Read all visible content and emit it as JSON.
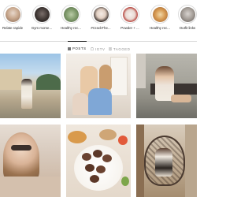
{
  "highlights": [
    {
      "label": "Relate rapide",
      "icon": "story-highlight-icon"
    },
    {
      "label": "Gym mome...",
      "icon": "story-highlight-icon"
    },
    {
      "label": "Healthy rec...",
      "icon": "story-highlight-icon"
    },
    {
      "label": "#CrackThe...",
      "icon": "story-highlight-icon"
    },
    {
      "label": "Powder + ...",
      "icon": "story-highlight-icon"
    },
    {
      "label": "Healthy rec...",
      "icon": "story-highlight-icon"
    },
    {
      "label": "Outfit links",
      "icon": "story-highlight-icon"
    }
  ],
  "tabs": [
    {
      "label": "POSTS",
      "icon": "grid-icon",
      "active": true
    },
    {
      "label": "IGTV",
      "icon": "igtv-icon",
      "active": false
    },
    {
      "label": "TAGGED",
      "icon": "tagged-icon",
      "active": false
    }
  ],
  "posts": [
    {
      "name": "post-street-outfit"
    },
    {
      "name": "post-family-photo"
    },
    {
      "name": "post-bench-pose"
    },
    {
      "name": "post-selfie-glasses"
    },
    {
      "name": "post-food-plate"
    },
    {
      "name": "post-hanging-chair"
    }
  ]
}
